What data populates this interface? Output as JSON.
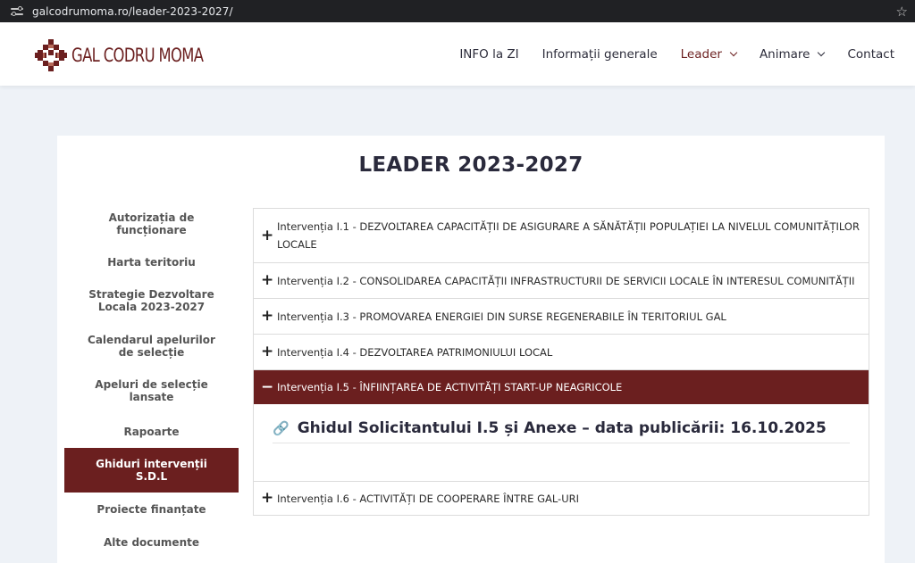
{
  "browser": {
    "url": "galcodrumoma.ro/leader-2023-2027/"
  },
  "header": {
    "logo_text": "GAL CODRU MOMA",
    "nav": [
      {
        "label": "INFO la ZI"
      },
      {
        "label": "Informații generale"
      },
      {
        "label": "Leader",
        "active": true
      },
      {
        "label": "Animare"
      },
      {
        "label": "Contact"
      }
    ]
  },
  "page": {
    "title": "LEADER 2023-2027"
  },
  "sidebar": {
    "items": [
      {
        "label": "Autorizația de funcționare"
      },
      {
        "label": "Harta teritoriu"
      },
      {
        "label": "Strategie Dezvoltare Locala 2023-2027"
      },
      {
        "label": "Calendarul apelurilor de selecție"
      },
      {
        "label": "Apeluri de selecție lansate"
      },
      {
        "label": "Rapoarte"
      },
      {
        "label": "Ghiduri intervenții S.D.L",
        "active": true
      },
      {
        "label": "Proiecte finanțate"
      },
      {
        "label": "Alte documente"
      }
    ]
  },
  "accordion": {
    "items": [
      {
        "label": "Intervenția I.1 - DEZVOLTAREA CAPACITĂȚII DE ASIGURARE A SĂNĂTĂȚII POPULAȚIEI LA NIVELUL COMUNITĂȚILOR LOCALE",
        "sign": "+"
      },
      {
        "label": "Intervenția I.2 - CONSOLIDAREA CAPACITĂȚII INFRASTRUCTURII DE SERVICII LOCALE ÎN INTERESUL COMUNITĂȚII",
        "sign": "+"
      },
      {
        "label": "Intervenția I.3 - PROMOVAREA ENERGIEI DIN SURSE REGENERABILE ÎN TERITORIUL GAL",
        "sign": "+"
      },
      {
        "label": "Intervenția I.4 - DEZVOLTAREA PATRIMONIULUI LOCAL",
        "sign": "+"
      },
      {
        "label": "Intervenția I.5 - ÎNFIINȚAREA DE ACTIVITĂȚI START-UP NEAGRICOLE",
        "sign": "−",
        "open": true,
        "doc": "Ghidul Solicitantului I.5 și Anexe – data publicării: 16.10.2025"
      },
      {
        "label": "Intervenția I.6 - ACTIVITĂȚI DE COOPERARE ÎNTRE GAL-URI",
        "sign": "+"
      }
    ]
  },
  "colors": {
    "brand": "#6b1f1f",
    "page_bg": "#eef2f7"
  },
  "icons": {
    "site_info": "tune-icon",
    "bookmark": "star-icon",
    "doc_link": "link-icon"
  }
}
